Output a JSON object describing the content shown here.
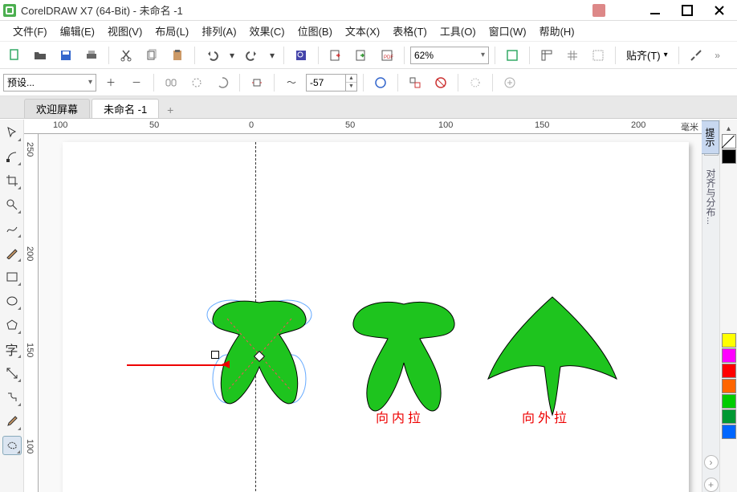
{
  "app": {
    "title": "CorelDRAW X7 (64-Bit) - 未命名 -1"
  },
  "menu": {
    "file": "文件(F)",
    "edit": "编辑(E)",
    "view": "视图(V)",
    "layout": "布局(L)",
    "arrange": "排列(A)",
    "effects": "效果(C)",
    "bitmaps": "位图(B)",
    "text": "文本(X)",
    "table": "表格(T)",
    "tools": "工具(O)",
    "window": "窗口(W)",
    "help": "帮助(H)"
  },
  "toolbar": {
    "zoom": "62%",
    "snap": "贴齐(T)"
  },
  "propbar": {
    "preset": "预设...",
    "rotation": "-57"
  },
  "tabs": {
    "welcome": "欢迎屏幕",
    "doc": "未命名 -1",
    "add": "+"
  },
  "ruler": {
    "unit": "毫米",
    "h": [
      "100",
      "50",
      "0",
      "50",
      "100",
      "150",
      "200"
    ],
    "v": [
      "250",
      "200",
      "150",
      "100"
    ]
  },
  "canvas": {
    "label_in": "向内拉",
    "label_out": "向外拉"
  },
  "docker": {
    "hint": "提示",
    "align": "对齐与分布..."
  },
  "palette_colors": [
    "#000000",
    "#663300",
    "#808080",
    "#ffffff",
    "#ffff00",
    "#ff9900",
    "#ff00ff",
    "#ff0000",
    "#00ff00",
    "#009900",
    "#0066ff"
  ],
  "tool_icons": [
    "pick",
    "shape",
    "crop",
    "zoom",
    "freehand",
    "smart",
    "rectangle",
    "ellipse",
    "polygon",
    "text",
    "dimension",
    "connector",
    "dropper",
    "fill",
    "outline"
  ]
}
